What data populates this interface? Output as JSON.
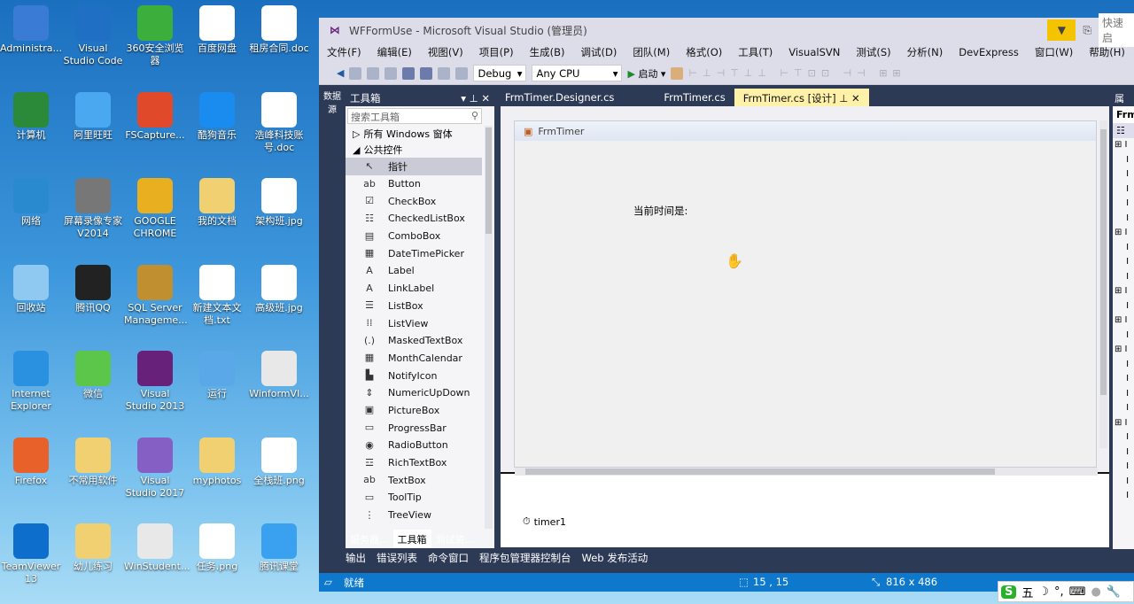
{
  "desktop": {
    "icons": [
      {
        "label": "Administra...",
        "color": "#3a7bd5"
      },
      {
        "label": "Visual Studio Code",
        "color": "#1f6fc5"
      },
      {
        "label": "360安全浏览器",
        "color": "#3cae3c"
      },
      {
        "label": "百度网盘",
        "color": "#ffffff"
      },
      {
        "label": "租房合同.doc",
        "color": "#ffffff"
      },
      {
        "label": "计算机",
        "color": "#2a8a3a"
      },
      {
        "label": "阿里旺旺",
        "color": "#4aa8f0"
      },
      {
        "label": "FSCapture...",
        "color": "#e04a2a"
      },
      {
        "label": "酷狗音乐",
        "color": "#1a8cf0"
      },
      {
        "label": "浩峰科技账号.doc",
        "color": "#ffffff"
      },
      {
        "label": "网络",
        "color": "#2a8ad0"
      },
      {
        "label": "屏幕录像专家V2014",
        "color": "#777777"
      },
      {
        "label": "GOOGLE CHROME",
        "color": "#e8b020"
      },
      {
        "label": "我的文档",
        "color": "#f0d070"
      },
      {
        "label": "架构班.jpg",
        "color": "#ffffff"
      },
      {
        "label": "回收站",
        "color": "#8fc8f0"
      },
      {
        "label": "腾讯QQ",
        "color": "#222222"
      },
      {
        "label": "SQL Server Manageme...",
        "color": "#c09030"
      },
      {
        "label": "新建文本文档.txt",
        "color": "#ffffff"
      },
      {
        "label": "高级班.jpg",
        "color": "#ffffff"
      },
      {
        "label": "Internet Explorer",
        "color": "#2a90e0"
      },
      {
        "label": "微信",
        "color": "#5cc64a"
      },
      {
        "label": "Visual Studio 2013",
        "color": "#68217a"
      },
      {
        "label": "运行",
        "color": "#5aa8e8"
      },
      {
        "label": "WinformVI...",
        "color": "#e8e8e8"
      },
      {
        "label": "Firefox",
        "color": "#e8602a"
      },
      {
        "label": "不常用软件",
        "color": "#f0d070"
      },
      {
        "label": "Visual Studio 2017",
        "color": "#865fc5"
      },
      {
        "label": "myphotos",
        "color": "#f0d070"
      },
      {
        "label": "全栈班.png",
        "color": "#ffffff"
      },
      {
        "label": "TeamViewer 13",
        "color": "#0e6ecc"
      },
      {
        "label": "幼儿练习",
        "color": "#f0d070"
      },
      {
        "label": "WinStudent...",
        "color": "#e8e8e8"
      },
      {
        "label": "任务.png",
        "color": "#ffffff"
      },
      {
        "label": "腾讯课堂",
        "color": "#3aa0f0"
      }
    ]
  },
  "window": {
    "title": "WFFormUse - Microsoft Visual Studio (管理员)",
    "quick_launch": "快速启"
  },
  "menu": [
    "文件(F)",
    "编辑(E)",
    "视图(V)",
    "项目(P)",
    "生成(B)",
    "调试(D)",
    "团队(M)",
    "格式(O)",
    "工具(T)",
    "VisualSVN",
    "测试(S)",
    "分析(N)",
    "DevExpress",
    "窗口(W)",
    "帮助(H)"
  ],
  "toolbar": {
    "config": "Debug",
    "platform": "Any CPU",
    "start": "启动"
  },
  "tabs": [
    {
      "label": "FrmTimer.Designer.cs"
    },
    {
      "label": "FrmTimer.cs"
    },
    {
      "label": "FrmTimer.cs [设计]",
      "active": true
    }
  ],
  "side_strip": "数据源",
  "toolbox": {
    "title": "工具箱",
    "search_placeholder": "搜索工具箱",
    "groups": [
      "所有 Windows 窗体",
      "公共控件"
    ],
    "items": [
      {
        "label": "指针",
        "icon": "↖"
      },
      {
        "label": "Button",
        "icon": "ab"
      },
      {
        "label": "CheckBox",
        "icon": "☑"
      },
      {
        "label": "CheckedListBox",
        "icon": "☷"
      },
      {
        "label": "ComboBox",
        "icon": "▤"
      },
      {
        "label": "DateTimePicker",
        "icon": "▦"
      },
      {
        "label": "Label",
        "icon": "A"
      },
      {
        "label": "LinkLabel",
        "icon": "A"
      },
      {
        "label": "ListBox",
        "icon": "☰"
      },
      {
        "label": "ListView",
        "icon": "⁞⁞"
      },
      {
        "label": "MaskedTextBox",
        "icon": "(.)"
      },
      {
        "label": "MonthCalendar",
        "icon": "▦"
      },
      {
        "label": "NotifyIcon",
        "icon": "▙"
      },
      {
        "label": "NumericUpDown",
        "icon": "⇕"
      },
      {
        "label": "PictureBox",
        "icon": "▣"
      },
      {
        "label": "ProgressBar",
        "icon": "▭"
      },
      {
        "label": "RadioButton",
        "icon": "◉"
      },
      {
        "label": "RichTextBox",
        "icon": "☲"
      },
      {
        "label": "TextBox",
        "icon": "ab"
      },
      {
        "label": "ToolTip",
        "icon": "▭"
      },
      {
        "label": "TreeView",
        "icon": "⋮"
      }
    ],
    "bottom_tabs": [
      "服务器...",
      "工具箱",
      "测试资..."
    ]
  },
  "designer": {
    "form_title": "FrmTimer",
    "label_text": "当前时间是:",
    "component": "timer1"
  },
  "properties": {
    "title": "属性",
    "object": "Frm"
  },
  "bottom_panels": [
    "输出",
    "错误列表",
    "命令窗口",
    "程序包管理器控制台",
    "Web 发布活动"
  ],
  "status": {
    "text": "就绪",
    "position": "15 , 15",
    "size": "816 x 486"
  },
  "ime": {
    "mode": "五"
  }
}
